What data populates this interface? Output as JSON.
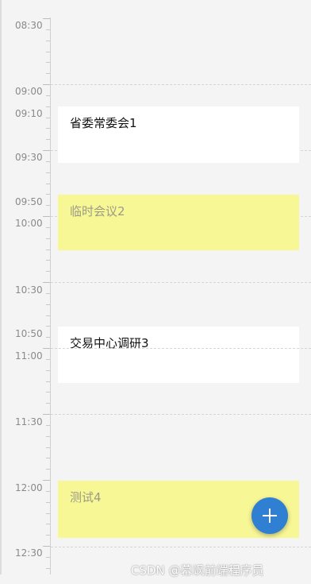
{
  "timeline": {
    "labels": [
      "08:30",
      "09:00",
      "09:10",
      "09:30",
      "09:50",
      "10:00",
      "10:30",
      "10:50",
      "11:00",
      "11:30",
      "12:00",
      "12:30"
    ]
  },
  "events": [
    {
      "title": "省委常委会1",
      "style": "white"
    },
    {
      "title": "临时会议2",
      "style": "yellow"
    },
    {
      "title": "交易中心调研3",
      "style": "white"
    },
    {
      "title": "测试4",
      "style": "yellow"
    }
  ],
  "add_button": {
    "icon": "plus-icon",
    "color": "#2f7fd3"
  },
  "watermark": "CSDN @幕飒前端程序员",
  "colors": {
    "accent": "#2f7fd3",
    "event_yellow": "#f8f796",
    "event_white": "#ffffff",
    "background": "#f4f4f4"
  }
}
